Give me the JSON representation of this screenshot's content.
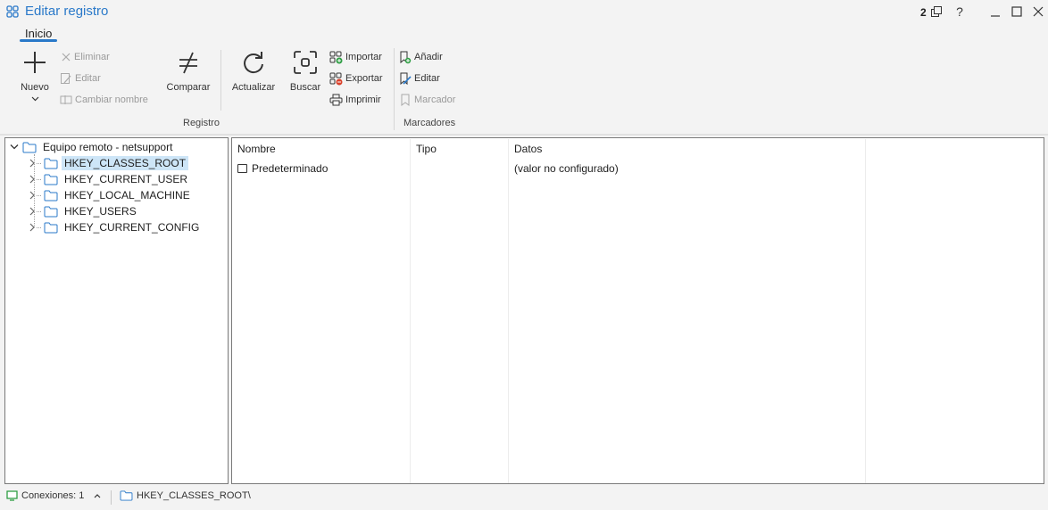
{
  "window": {
    "title": "Editar registro",
    "badge": "2",
    "help": "?",
    "accent": "#2a79c9"
  },
  "tabs": [
    {
      "label": "Inicio",
      "active": true
    }
  ],
  "ribbon": {
    "nuevo": "Nuevo",
    "eliminar": "Eliminar",
    "editar": "Editar",
    "cambiar_nombre": "Cambiar nombre",
    "comparar": "Comparar",
    "registro_group": "Registro",
    "actualizar": "Actualizar",
    "buscar": "Buscar",
    "importar": "Importar",
    "exportar": "Exportar",
    "imprimir": "Imprimir",
    "anadir": "Añadir",
    "editar_marcador": "Editar",
    "marcador": "Marcador",
    "marcadores_group": "Marcadores"
  },
  "tree": {
    "root": "Equipo remoto - netsupport",
    "children": [
      {
        "label": "HKEY_CLASSES_ROOT",
        "selected": true
      },
      {
        "label": "HKEY_CURRENT_USER",
        "selected": false
      },
      {
        "label": "HKEY_LOCAL_MACHINE",
        "selected": false
      },
      {
        "label": "HKEY_USERS",
        "selected": false
      },
      {
        "label": "HKEY_CURRENT_CONFIG",
        "selected": false
      }
    ]
  },
  "list": {
    "columns": [
      "Nombre",
      "Tipo",
      "Datos"
    ],
    "rows": [
      {
        "nombre": "Predeterminado",
        "tipo": "",
        "datos": "(valor no configurado)"
      }
    ]
  },
  "status": {
    "connections": "Conexiones: 1",
    "path": "HKEY_CLASSES_ROOT\\"
  }
}
